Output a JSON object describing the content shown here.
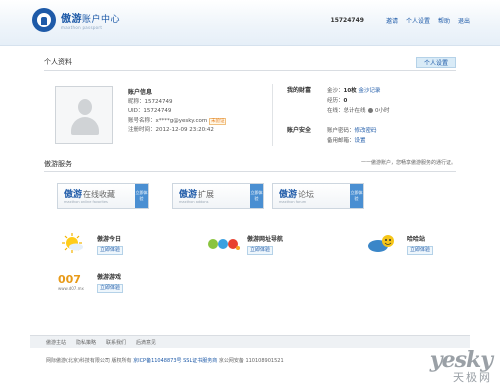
{
  "header": {
    "brand": "傲游",
    "brand_sub": "账户中心",
    "brand_en": "maxthon passport",
    "user_id": "15724749",
    "links": [
      "邀请",
      "个人设置",
      "帮助",
      "退出"
    ]
  },
  "profile": {
    "section_title": "个人资料",
    "settings_button": "个人设置",
    "account_info": {
      "heading": "账户信息",
      "nickname": "昵称：15724749",
      "uid": "UID：15724749",
      "email": "账号名称：x****g@yesky.com",
      "email_status": "未验证",
      "registered": "注册时间：2012-12-09 23:20:42"
    },
    "assets": {
      "heading": "我的财富",
      "gold_label": "金沙：",
      "gold_value": "10枚",
      "gold_link": "金沙记录",
      "rank_label": "经历：",
      "rank_value": "0",
      "online_label": "在线：",
      "online_value": "总计在线",
      "online_hours": "0小时"
    },
    "security": {
      "heading": "账户安全",
      "password_label": "账户密码：",
      "password_link": "修改密码",
      "backup_label": "备用邮箱：",
      "backup_link": "设置"
    }
  },
  "services": {
    "section_title": "傲游服务",
    "note": "一一傲游账户，您畅享傲游服务的通行证。",
    "boxes": [
      {
        "brand": "傲游",
        "name": "在线收藏",
        "en": "maxthon online favorites",
        "go": "立即体验"
      },
      {
        "brand": "傲游",
        "name": "扩展",
        "en": "maxthon addons",
        "go": "立即体验"
      },
      {
        "brand": "傲游",
        "name": "论坛",
        "en": "maxthon forum",
        "go": "立即体验"
      }
    ]
  },
  "games": [
    {
      "name": "傲游今日",
      "play": "立即体验",
      "icon": "sun-icon"
    },
    {
      "name": "傲游网址导航",
      "play": "立即体验",
      "icon": "466-logo-icon"
    },
    {
      "name": "哈哈站",
      "play": "立即体验",
      "icon": "haha-icon"
    },
    {
      "name": "傲游游戏",
      "play": "立即体验",
      "icon": "007-logo-icon",
      "logo_text": "007",
      "logo_sub": "www.d07.mx"
    }
  ],
  "footer": {
    "links": [
      "傲游主站",
      "隐私策略",
      "联系我们",
      "后滴意见"
    ],
    "copy_prefix": "网际傲游(北京)科技有限公司 版权所有",
    "icp": "京ICP备11048873号",
    "ssl": "SSL证书服务商",
    "police": "京公网安备 110108901521"
  },
  "watermark": {
    "main": "yesky",
    "sub": "天极网"
  }
}
